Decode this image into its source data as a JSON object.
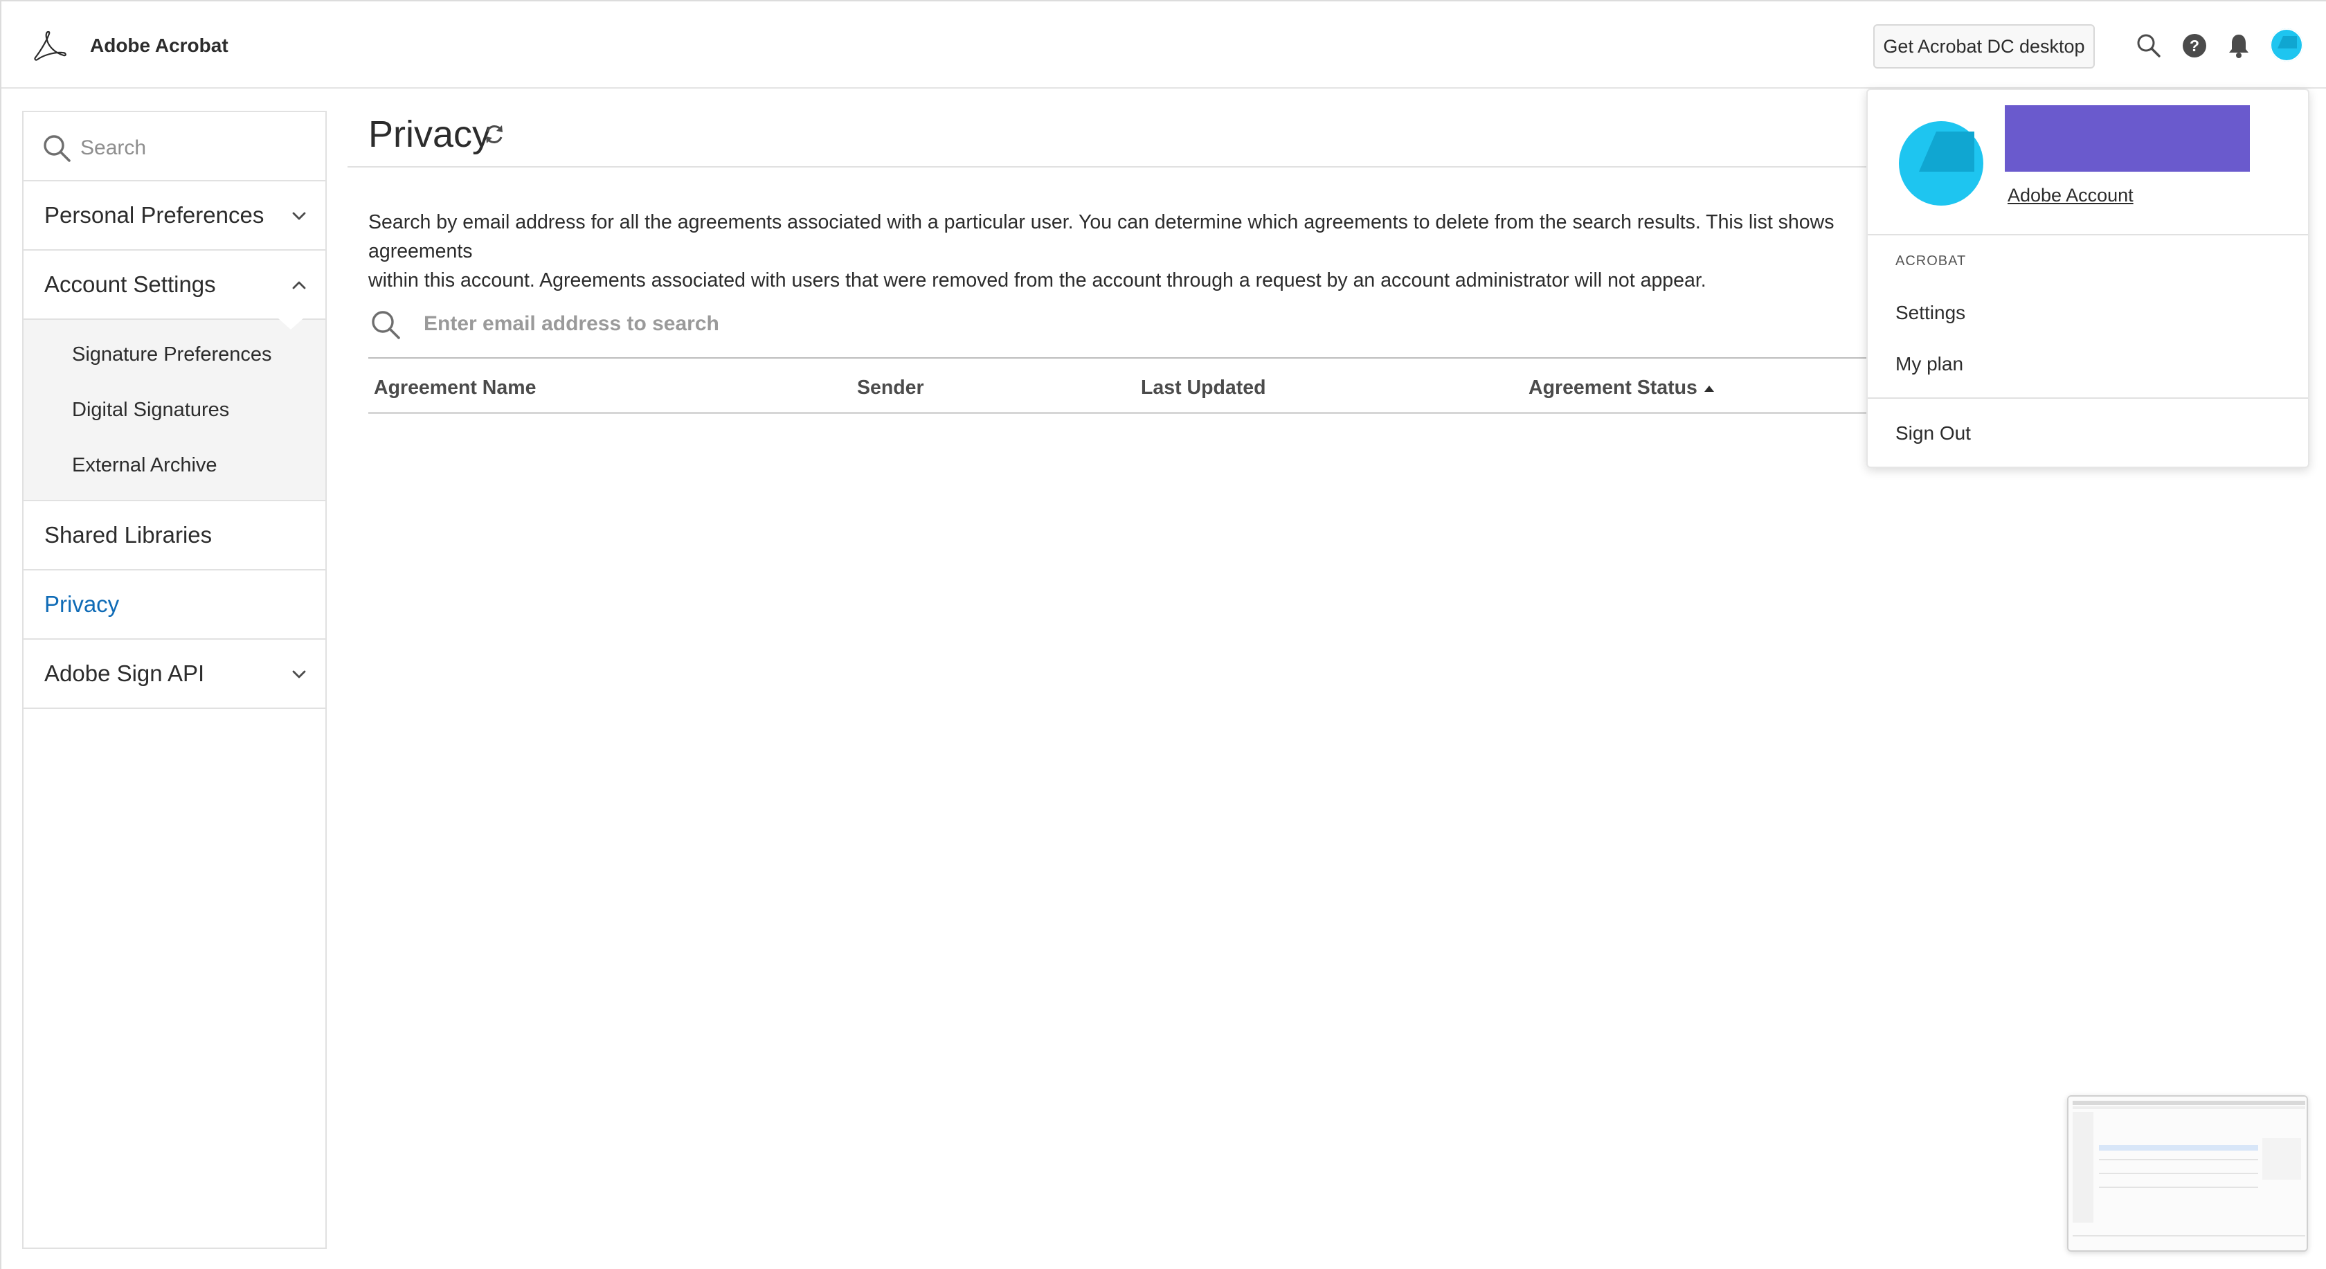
{
  "header": {
    "app_title": "Adobe Acrobat",
    "get_desktop_label": "Get Acrobat DC desktop",
    "icons": [
      "acrobat-logo-icon",
      "search-icon",
      "help-icon",
      "bell-icon",
      "avatar-icon"
    ]
  },
  "sidebar": {
    "search_placeholder": "Search",
    "items": [
      {
        "label": "Personal Preferences",
        "expanded": false
      },
      {
        "label": "Account Settings",
        "expanded": true,
        "children": [
          "Signature Preferences",
          "Digital Signatures",
          "External Archive"
        ]
      },
      {
        "label": "Shared Libraries"
      },
      {
        "label": "Privacy",
        "active": true
      },
      {
        "label": "Adobe Sign API",
        "expanded": false
      }
    ]
  },
  "main": {
    "title": "Privacy",
    "description": "Search by email address for all the agreements associated with a particular user. You can determine which agreements to delete from the search results. This list shows agreements\nwithin this account. Agreements associated with users that were removed from the account through a request by an account administrator will not appear.",
    "email_search_placeholder": "Enter email address to search",
    "table": {
      "columns": [
        "Agreement Name",
        "Sender",
        "Last Updated",
        "Agreement Status"
      ],
      "sorted_column": "Agreement Status",
      "sort_direction": "ascending",
      "rows": []
    }
  },
  "account_menu": {
    "account_link": "Adobe Account",
    "section_label": "ACROBAT",
    "items": [
      "Settings",
      "My plan"
    ],
    "sign_out": "Sign Out"
  },
  "colors": {
    "active_link": "#0f6bb6",
    "avatar": "#1ec5f0",
    "redaction": "#6a5acd",
    "divider": "#e1e1e1"
  }
}
